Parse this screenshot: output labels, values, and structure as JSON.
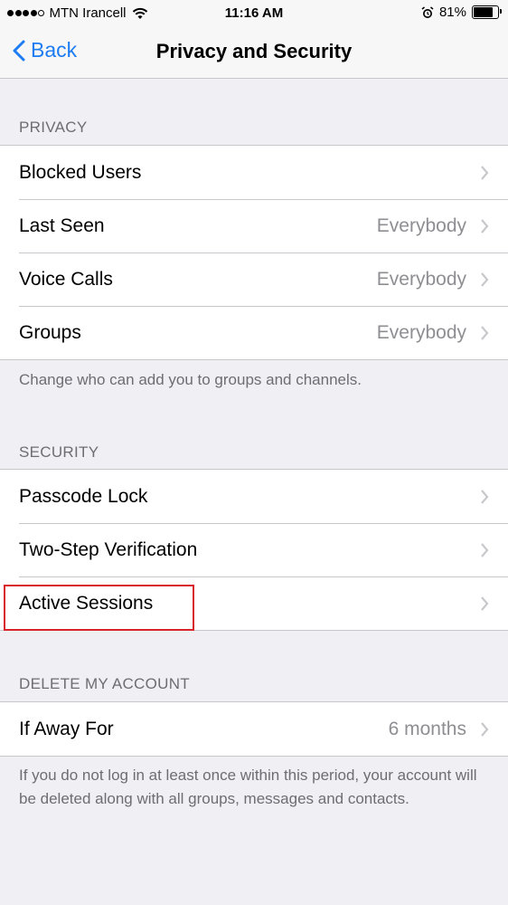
{
  "status_bar": {
    "carrier": "MTN Irancell",
    "time": "11:16 AM",
    "battery_percent": "81%",
    "battery_level": 0.81,
    "signal_bars": 4
  },
  "nav": {
    "back_label": "Back",
    "title": "Privacy and Security"
  },
  "privacy": {
    "header": "PRIVACY",
    "rows": [
      {
        "label": "Blocked Users",
        "value": ""
      },
      {
        "label": "Last Seen",
        "value": "Everybody"
      },
      {
        "label": "Voice Calls",
        "value": "Everybody"
      },
      {
        "label": "Groups",
        "value": "Everybody"
      }
    ],
    "footer": "Change who can add you to groups and channels."
  },
  "security": {
    "header": "SECURITY",
    "rows": [
      {
        "label": "Passcode Lock"
      },
      {
        "label": "Two-Step Verification"
      },
      {
        "label": "Active Sessions"
      }
    ]
  },
  "delete_account": {
    "header": "DELETE MY ACCOUNT",
    "rows": [
      {
        "label": "If Away For",
        "value": "6 months"
      }
    ],
    "footer": "If you do not log in at least once within this period, your account will be deleted along with all groups, messages and contacts."
  },
  "colors": {
    "accent": "#1d7cf2",
    "highlight": "#d9232a",
    "background": "#efeff4"
  }
}
